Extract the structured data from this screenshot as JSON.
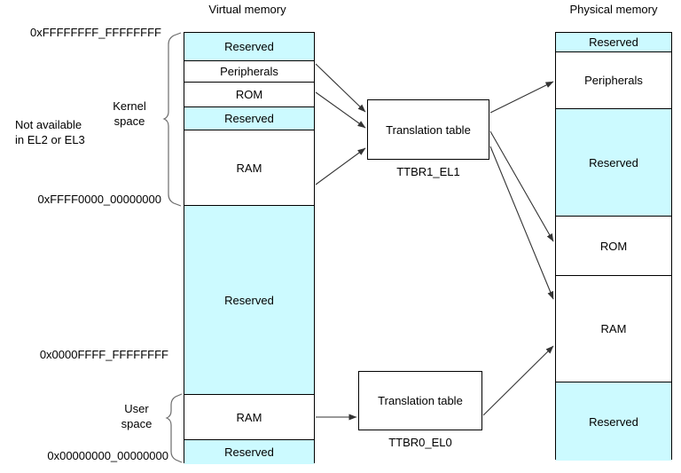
{
  "diagram": {
    "title_virtual": "Virtual memory",
    "title_physical": "Physical memory"
  },
  "virtual_memory": {
    "title": "Virtual memory",
    "blocks": [
      {
        "label": "Reserved",
        "fill": "#ccfaff"
      },
      {
        "label": "Peripherals",
        "fill": "#ffffff"
      },
      {
        "label": "ROM",
        "fill": "#ffffff"
      },
      {
        "label": "Reserved",
        "fill": "#ccfaff"
      },
      {
        "label": "RAM",
        "fill": "#ffffff"
      },
      {
        "label": "Reserved",
        "fill": "#ccfaff"
      },
      {
        "label": "RAM",
        "fill": "#ffffff"
      },
      {
        "label": "Reserved",
        "fill": "#ccfaff"
      }
    ],
    "addresses": {
      "top": "0xFFFFFFFF_FFFFFFFF",
      "kernel_base": "0xFFFF0000_00000000",
      "user_top": "0x0000FFFF_FFFFFFFF",
      "bottom": "0x00000000_00000000"
    },
    "regions": {
      "kernel_space": "Kernel\nspace",
      "kernel_space_line1": "Kernel",
      "kernel_space_line2": "space",
      "user_space_line1": "User",
      "user_space_line2": "space"
    },
    "note_line1": "Not available",
    "note_line2": "in EL2 or EL3"
  },
  "translation_tables": [
    {
      "box_label": "Translation table",
      "register": "TTBR1_EL1"
    },
    {
      "box_label": "Translation table",
      "register": "TTBR0_EL0"
    }
  ],
  "physical_memory": {
    "title": "Physical memory",
    "blocks": [
      {
        "label": "Reserved",
        "fill": "#ccfaff"
      },
      {
        "label": "Peripherals",
        "fill": "#ffffff"
      },
      {
        "label": "Reserved",
        "fill": "#ccfaff"
      },
      {
        "label": "ROM",
        "fill": "#ffffff"
      },
      {
        "label": "RAM",
        "fill": "#ffffff"
      },
      {
        "label": "Reserved",
        "fill": "#ccfaff"
      }
    ]
  },
  "colors": {
    "reserved_fill": "#ccfaff",
    "plain_fill": "#ffffff",
    "stroke": "#000000",
    "background": "#ffffff"
  }
}
